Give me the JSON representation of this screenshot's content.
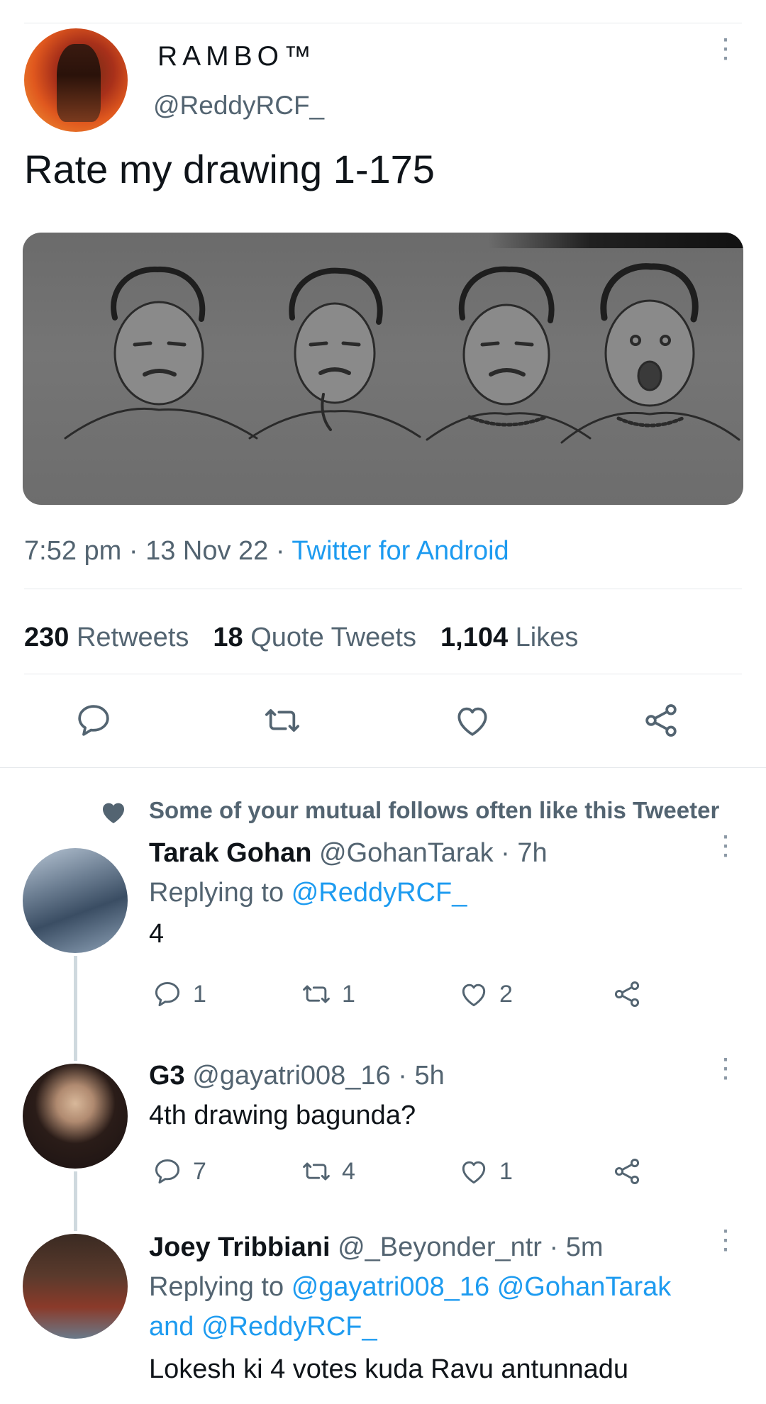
{
  "tweet": {
    "display_name": "RAMBO™",
    "handle": "@ReddyRCF_",
    "text": "Rate my drawing 1-175",
    "time": "7:52 pm",
    "date": "13 Nov 22",
    "source": "Twitter for Android",
    "stats": {
      "retweets_count": "230",
      "retweets_label": "Retweets",
      "quotes_count": "18",
      "quotes_label": "Quote Tweets",
      "likes_count": "1,104",
      "likes_label": "Likes"
    }
  },
  "social_context": "Some of your mutual follows often like this Tweeter",
  "replies": [
    {
      "name": "Tarak Gohan",
      "handle": "@GohanTarak",
      "time": "7h",
      "replying_prefix": "Replying to",
      "replying_to": "@ReddyRCF_",
      "text": "4",
      "reply_count": "1",
      "retweet_count": "1",
      "like_count": "2"
    },
    {
      "name": "G3",
      "handle": "@gayatri008_16",
      "time": "5h",
      "text": "4th drawing bagunda?",
      "reply_count": "7",
      "retweet_count": "4",
      "like_count": "1"
    },
    {
      "name": "Joey Tribbiani",
      "handle": "@_Beyonder_ntr",
      "time": "5m",
      "replying_prefix": "Replying to",
      "replying_to_1": "@gayatri008_16",
      "replying_to_2": "@GohanTarak",
      "replying_and": "and",
      "replying_to_3": "@ReddyRCF_",
      "text": "Lokesh ki 4 votes kuda Ravu antunnadu"
    }
  ],
  "icons": {
    "reply": "reply-icon",
    "retweet": "retweet-icon",
    "like": "heart-icon",
    "share": "share-icon",
    "more": "more-vertical-icon"
  },
  "colors": {
    "link": "#1d9bf0",
    "secondary_text": "#536471",
    "primary_text": "#0f1419"
  }
}
